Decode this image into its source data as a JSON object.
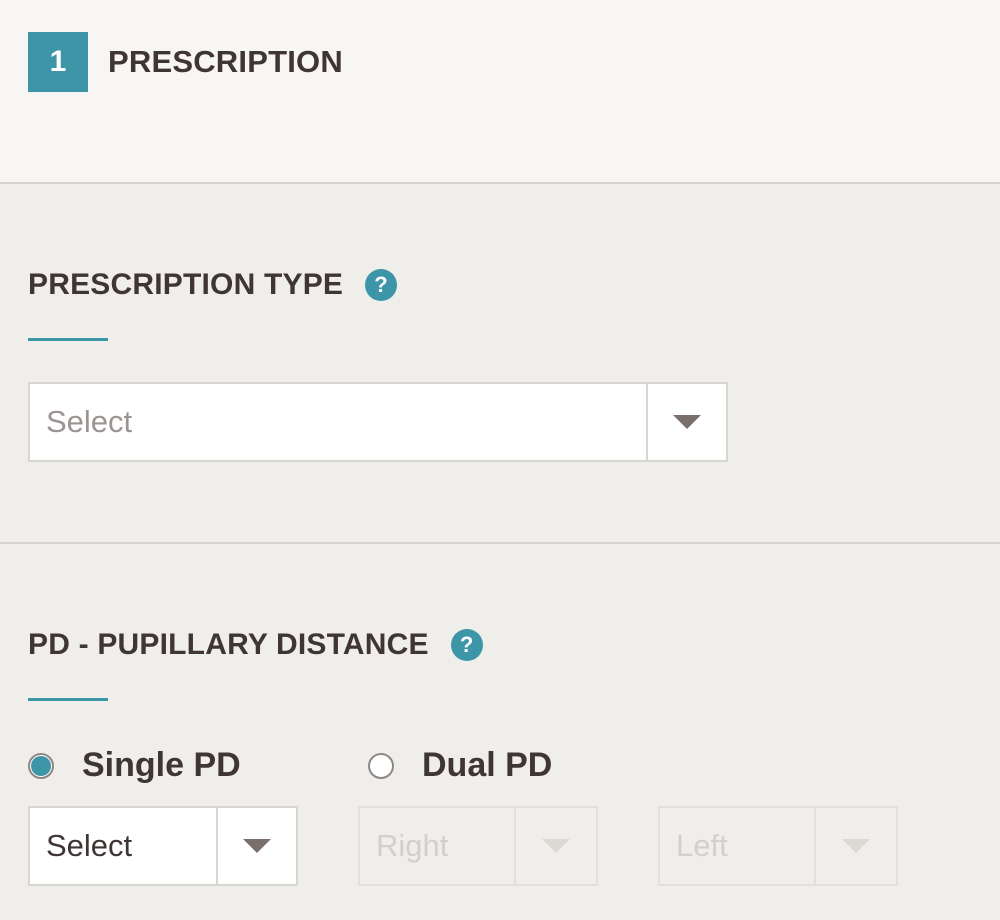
{
  "header": {
    "step_number": "1",
    "step_title": "PRESCRIPTION"
  },
  "prescription_type": {
    "title": "PRESCRIPTION TYPE",
    "help_glyph": "?",
    "select": {
      "value": "Select",
      "is_placeholder": true
    }
  },
  "pupillary_distance": {
    "title": "PD - PUPILLARY DISTANCE",
    "help_glyph": "?",
    "options": [
      {
        "label": "Single PD",
        "selected": true
      },
      {
        "label": "Dual PD",
        "selected": false
      }
    ],
    "single_select": {
      "value": "Select"
    },
    "dual_selects": [
      {
        "value": "Right",
        "disabled": true
      },
      {
        "value": "Left",
        "disabled": true
      }
    ]
  },
  "icons": {
    "help": "question-circle-icon",
    "dropdown": "caret-down-icon"
  },
  "colors": {
    "accent": "#3d95a8",
    "text": "#3f3534",
    "header_bg": "#f7f6f4",
    "page_bg": "#efeeeb"
  }
}
